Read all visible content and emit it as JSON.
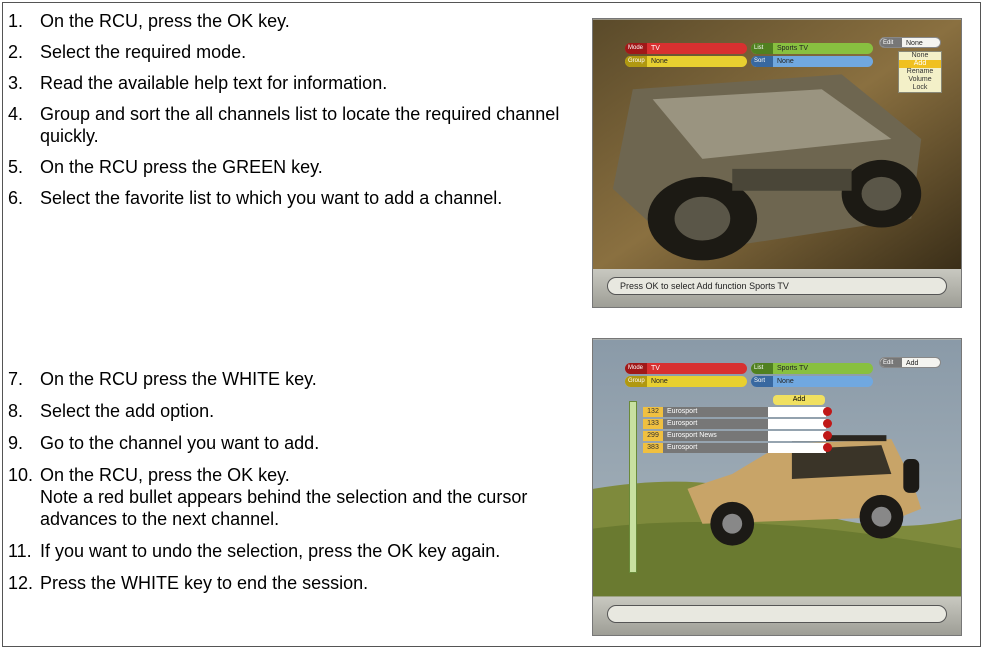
{
  "steps_group1": [
    {
      "num": "1.",
      "text": "On the RCU, press the OK key."
    },
    {
      "num": "2.",
      "text": "Select the required mode."
    },
    {
      "num": "3.",
      "text": "Read the available help text for information."
    },
    {
      "num": "4.",
      "text": "Group and sort the all channels list to locate the required channel quickly."
    },
    {
      "num": "5.",
      "text": "On the RCU press the GREEN key."
    },
    {
      "num": "6.",
      "text": "Select the favorite list to which you want to add a channel."
    }
  ],
  "steps_group2": [
    {
      "num": "7.",
      "text": "On the RCU press the WHITE key."
    },
    {
      "num": "8.",
      "text": "Select the add option."
    },
    {
      "num": "9.",
      "text": "Go to the channel you want to add."
    },
    {
      "num": "10.",
      "text": "On the RCU, press the OK key.",
      "note": "Note a red bullet appears behind the selection and the cursor advances to the next channel."
    },
    {
      "num": "11.",
      "text": "If you want to undo the selection, press the OK key again."
    },
    {
      "num": "12.",
      "text": "Press the WHITE key to end the session."
    }
  ],
  "screenshot1": {
    "osd_row1": [
      {
        "tag": "Mode",
        "value": "TV",
        "color": "#d83030"
      },
      {
        "tag": "List",
        "value": "Sports TV",
        "color": "#88c040"
      }
    ],
    "osd_row2": [
      {
        "tag": "Group",
        "value": "None",
        "color": "#e8d030"
      },
      {
        "tag": "Sort",
        "value": "None",
        "color": "#70a8e0"
      }
    ],
    "edit_tag": "Edit",
    "edit_value": "None",
    "menu_items": [
      "None",
      "Add",
      "Rename",
      "Volume",
      "Lock"
    ],
    "menu_selected": "Add",
    "status_text": "Press OK to select Add function Sports TV"
  },
  "screenshot2": {
    "osd_row1": [
      {
        "tag": "Mode",
        "value": "TV",
        "color": "#d83030"
      },
      {
        "tag": "List",
        "value": "Sports TV",
        "color": "#88c040"
      }
    ],
    "osd_row2": [
      {
        "tag": "Group",
        "value": "None",
        "color": "#e8d030"
      },
      {
        "tag": "Sort",
        "value": "None",
        "color": "#70a8e0"
      }
    ],
    "edit_tag": "Edit",
    "edit_value": "Add",
    "add_header": "Add",
    "channels": [
      {
        "num": "132",
        "name": "Eurosport"
      },
      {
        "num": "133",
        "name": "Eurosport"
      },
      {
        "num": "299",
        "name": "Eurosport News"
      },
      {
        "num": "383",
        "name": "Eurosport"
      }
    ],
    "status_text": ""
  }
}
